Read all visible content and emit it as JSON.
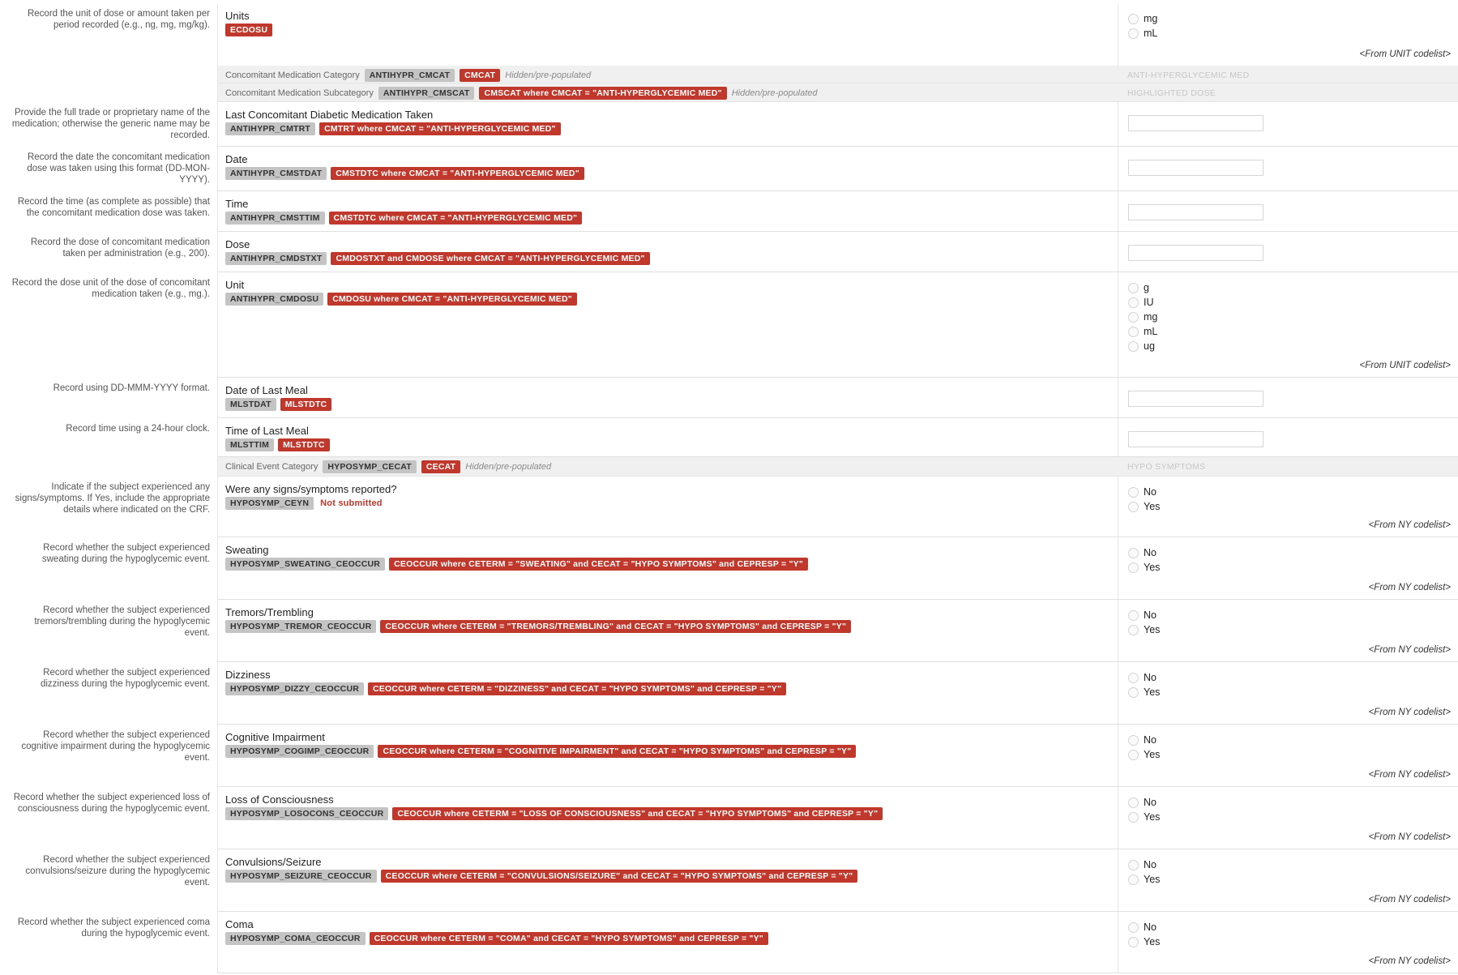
{
  "rows": [
    {
      "instruction": [
        "Record the unit of dose or amount taken per",
        "period recorded (e.g., ng, mg, mg/kg)."
      ],
      "label": "Units",
      "tags": [
        {
          "text": "ECDOSU",
          "kind": "map"
        }
      ],
      "options": [
        "mg",
        "mL"
      ],
      "codelist": "<From UNIT codelist>"
    },
    {
      "hidden": true,
      "label": "Concomitant Medication Category",
      "tags": [
        {
          "text": "ANTIHYPR_CMCAT",
          "kind": "var"
        },
        {
          "text": "CMCAT",
          "kind": "map"
        }
      ],
      "note": "Hidden/pre-populated",
      "prepopulated": "ANTI-HYPERGLYCEMIC MED"
    },
    {
      "hidden": true,
      "label": "Concomitant Medication Subcategory",
      "tags": [
        {
          "text": "ANTIHYPR_CMSCAT",
          "kind": "var"
        },
        {
          "text": "CMSCAT where CMCAT = \"ANTI-HYPERGLYCEMIC MED\"",
          "kind": "map"
        }
      ],
      "note": "Hidden/pre-populated",
      "prepopulated": "HIGHLIGHTED DOSE"
    },
    {
      "instruction": [
        "Provide the full trade or proprietary name of the",
        "medication; otherwise the generic name may be",
        "recorded."
      ],
      "label": "Last Concomitant Diabetic Medication Taken",
      "tags": [
        {
          "text": "ANTIHYPR_CMTRT",
          "kind": "var"
        },
        {
          "text": "CMTRT where CMCAT = \"ANTI-HYPERGLYCEMIC MED\"",
          "kind": "map"
        }
      ],
      "textbox": true
    },
    {
      "instruction": [
        "Record the date the concomitant medication",
        "dose was taken using this format (DD-MON-",
        "YYYY)."
      ],
      "label": "Date",
      "tags": [
        {
          "text": "ANTIHYPR_CMSTDAT",
          "kind": "var"
        },
        {
          "text": "CMSTDTC where CMCAT = \"ANTI-HYPERGLYCEMIC MED\"",
          "kind": "map"
        }
      ],
      "textbox": true
    },
    {
      "instruction": [
        "Record the time (as complete as possible) that",
        "the concomitant medication dose was taken."
      ],
      "label": "Time",
      "tags": [
        {
          "text": "ANTIHYPR_CMSTTIM",
          "kind": "var"
        },
        {
          "text": "CMSTDTC where CMCAT = \"ANTI-HYPERGLYCEMIC MED\"",
          "kind": "map"
        }
      ],
      "textbox": true
    },
    {
      "instruction": [
        "Record the dose of concomitant medication",
        "taken per administration (e.g., 200)."
      ],
      "label": "Dose",
      "tags": [
        {
          "text": "ANTIHYPR_CMDSTXT",
          "kind": "var"
        },
        {
          "text": "CMDOSTXT and CMDOSE where CMCAT = \"ANTI-HYPERGLYCEMIC MED\"",
          "kind": "map"
        }
      ],
      "textbox": true
    },
    {
      "instruction": [
        "Record the dose unit of the dose of concomitant",
        "medication taken (e.g., mg.)."
      ],
      "label": "Unit",
      "tags": [
        {
          "text": "ANTIHYPR_CMDOSU",
          "kind": "var"
        },
        {
          "text": "CMDOSU where CMCAT = \"ANTI-HYPERGLYCEMIC MED\"",
          "kind": "map"
        }
      ],
      "options": [
        "g",
        "IU",
        "mg",
        "mL",
        "ug"
      ],
      "codelist": "<From UNIT codelist>"
    },
    {
      "instruction": [
        "Record using DD-MMM-YYYY format."
      ],
      "label": "Date of Last Meal",
      "tags": [
        {
          "text": "MLSTDAT",
          "kind": "var"
        },
        {
          "text": "MLSTDTC",
          "kind": "map"
        }
      ],
      "textbox": true
    },
    {
      "instruction": [
        "Record time using a 24-hour clock."
      ],
      "label": "Time of Last Meal",
      "tags": [
        {
          "text": "MLSTTIM",
          "kind": "var"
        },
        {
          "text": "MLSTDTC",
          "kind": "map"
        }
      ],
      "textbox": true
    },
    {
      "hidden": true,
      "label": "Clinical Event Category",
      "tags": [
        {
          "text": "HYPOSYMP_CECAT",
          "kind": "var"
        },
        {
          "text": "CECAT",
          "kind": "map"
        }
      ],
      "note": "Hidden/pre-populated",
      "prepopulated": "HYPO SYMPTOMS"
    },
    {
      "instruction": [
        "Indicate if the subject experienced any",
        "signs/symptoms. If Yes, include the appropriate",
        "details where indicated on the CRF."
      ],
      "label": "Were any signs/symptoms reported?",
      "tags": [
        {
          "text": "HYPOSYMP_CEYN",
          "kind": "var"
        },
        {
          "text": "Not submitted",
          "kind": "ns"
        }
      ],
      "options": [
        "No",
        "Yes"
      ],
      "codelist": "<From NY codelist>"
    },
    {
      "instruction": [
        "Record whether the subject experienced",
        "sweating during the hypoglycemic event."
      ],
      "label": "Sweating",
      "tags": [
        {
          "text": "HYPOSYMP_SWEATING_CEOCCUR",
          "kind": "var"
        },
        {
          "text": "CEOCCUR where CETERM = \"SWEATING\" and CECAT = \"HYPO SYMPTOMS\" and CEPRESP = \"Y\"",
          "kind": "map"
        }
      ],
      "options": [
        "No",
        "Yes"
      ],
      "codelist": "<From NY codelist>"
    },
    {
      "instruction": [
        "Record whether the subject experienced",
        "tremors/trembling during the hypoglycemic",
        "event."
      ],
      "label": "Tremors/Trembling",
      "tags": [
        {
          "text": "HYPOSYMP_TREMOR_CEOCCUR",
          "kind": "var"
        },
        {
          "text": "CEOCCUR where CETERM = \"TREMORS/TREMBLING\" and CECAT = \"HYPO SYMPTOMS\" and CEPRESP = \"Y\"",
          "kind": "map"
        }
      ],
      "options": [
        "No",
        "Yes"
      ],
      "codelist": "<From NY codelist>"
    },
    {
      "instruction": [
        "Record whether the subject experienced",
        "dizziness during the hypoglycemic event."
      ],
      "label": "Dizziness",
      "tags": [
        {
          "text": "HYPOSYMP_DIZZY_CEOCCUR",
          "kind": "var"
        },
        {
          "text": "CEOCCUR where CETERM = \"DIZZINESS\" and CECAT = \"HYPO SYMPTOMS\" and CEPRESP = \"Y\"",
          "kind": "map"
        }
      ],
      "options": [
        "No",
        "Yes"
      ],
      "codelist": "<From NY codelist>"
    },
    {
      "instruction": [
        "Record whether the subject experienced",
        "cognitive impairment during the hypoglycemic",
        "event."
      ],
      "label": "Cognitive Impairment",
      "tags": [
        {
          "text": "HYPOSYMP_COGIMP_CEOCCUR",
          "kind": "var"
        },
        {
          "text": "CEOCCUR where CETERM = \"COGNITIVE IMPAIRMENT\" and CECAT = \"HYPO SYMPTOMS\" and CEPRESP = \"Y\"",
          "kind": "map"
        }
      ],
      "options": [
        "No",
        "Yes"
      ],
      "codelist": "<From NY codelist>"
    },
    {
      "instruction": [
        "Record whether the subject experienced loss of",
        "consciousness during the hypoglycemic event."
      ],
      "label": "Loss of Consciousness",
      "tags": [
        {
          "text": "HYPOSYMP_LOSOCONS_CEOCCUR",
          "kind": "var"
        },
        {
          "text": "CEOCCUR where CETERM = \"LOSS OF CONSCIOUSNESS\" and CECAT = \"HYPO SYMPTOMS\" and CEPRESP = \"Y\"",
          "kind": "map"
        }
      ],
      "options": [
        "No",
        "Yes"
      ],
      "codelist": "<From NY codelist>"
    },
    {
      "instruction": [
        "Record whether the subject experienced",
        "convulsions/seizure during the hypoglycemic",
        "event."
      ],
      "label": "Convulsions/Seizure",
      "tags": [
        {
          "text": "HYPOSYMP_SEIZURE_CEOCCUR",
          "kind": "var"
        },
        {
          "text": "CEOCCUR where CETERM = \"CONVULSIONS/SEIZURE\" and CECAT = \"HYPO SYMPTOMS\" and CEPRESP = \"Y\"",
          "kind": "map"
        }
      ],
      "options": [
        "No",
        "Yes"
      ],
      "codelist": "<From NY codelist>"
    },
    {
      "instruction": [
        "Record whether the subject experienced coma",
        "during the hypoglycemic event."
      ],
      "label": "Coma",
      "tags": [
        {
          "text": "HYPOSYMP_COMA_CEOCCUR",
          "kind": "var"
        },
        {
          "text": "CEOCCUR where CETERM = \"COMA\" and CECAT = \"HYPO SYMPTOMS\" and CEPRESP = \"Y\"",
          "kind": "map"
        }
      ],
      "options": [
        "No",
        "Yes"
      ],
      "codelist": "<From NY codelist>"
    }
  ]
}
